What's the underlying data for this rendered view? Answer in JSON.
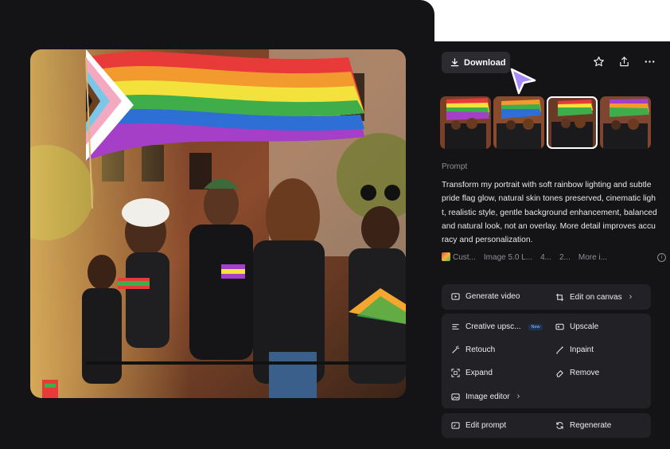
{
  "toolbar": {
    "download_label": "Download",
    "icons": [
      "download-icon",
      "star-icon",
      "share-icon",
      "more-icon"
    ]
  },
  "prompt": {
    "label": "Prompt",
    "text": "Transform my portrait with soft rainbow lighting and subtle pride flag glow, natural skin tones preserved, cinematic light, realistic style, gentle background enhancement, balanced and natural look, not an overlay. More detail improves accuracy and personalization."
  },
  "meta": {
    "style": "Cust...",
    "model": "Image 5.0 L...",
    "ratio": "4...",
    "count": "2...",
    "more": "More i..."
  },
  "thumbnails": {
    "count": 4,
    "selected_index": 2
  },
  "actions": {
    "generate_video": "Generate video",
    "edit_on_canvas": "Edit on canvas",
    "creative_upscale": "Creative upsc...",
    "new_badge": "New",
    "upscale": "Upscale",
    "retouch": "Retouch",
    "inpaint": "Inpaint",
    "expand": "Expand",
    "remove": "Remove",
    "image_editor": "Image editor",
    "edit_prompt": "Edit prompt",
    "regenerate": "Regenerate"
  },
  "colors": {
    "panel_bg": "#141416",
    "group_bg": "#222226",
    "cursor": "#a78bfa",
    "text": "#ececf0",
    "muted": "#8e8e96"
  }
}
